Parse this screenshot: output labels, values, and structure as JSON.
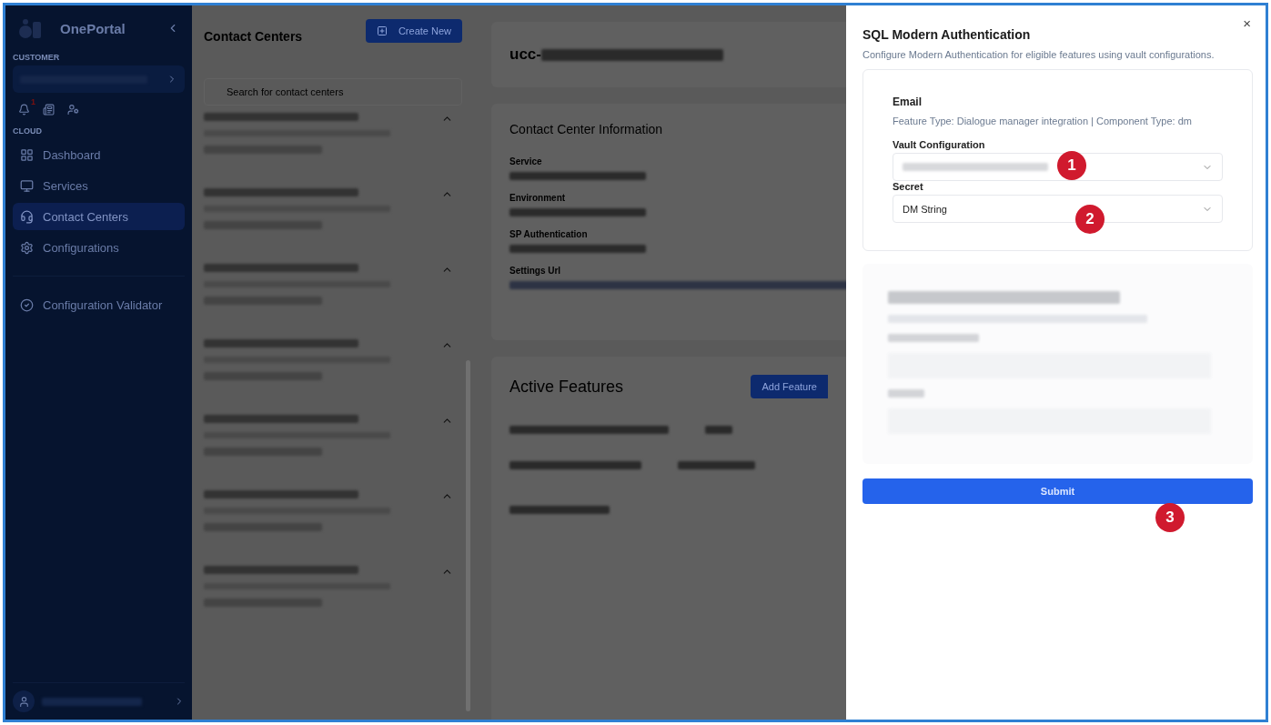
{
  "sidebar": {
    "brand": "OnePortal",
    "customer_label": "CUSTOMER",
    "notification_count": "1",
    "cloud_label": "CLOUD",
    "items": [
      {
        "label": "Dashboard",
        "kind": "grid",
        "selected": false
      },
      {
        "label": "Services",
        "kind": "monitor",
        "selected": false
      },
      {
        "label": "Contact Centers",
        "kind": "headset",
        "selected": true
      },
      {
        "label": "Configurations",
        "kind": "gear",
        "selected": false
      }
    ],
    "footer_items": [
      {
        "label": "Configuration Validator",
        "kind": "check",
        "selected": false
      }
    ]
  },
  "contact_centers": {
    "title": "Contact Centers",
    "create_button": "Create New",
    "search": {
      "placeholder": "Search for contact centers"
    },
    "items": [
      {
        "expanded": true
      },
      {
        "expanded": true
      },
      {
        "expanded": true
      },
      {
        "expanded": true
      },
      {
        "expanded": true
      },
      {
        "expanded": true
      },
      {
        "expanded": true
      }
    ]
  },
  "detail": {
    "title_prefix": "ucc-",
    "info_title": "Contact Center Information",
    "fields": [
      "Service",
      "Environment",
      "SP Authentication",
      "Settings Url"
    ],
    "features_title": "Active Features",
    "add_button": "Add Feature"
  },
  "dialog": {
    "title": "SQL Modern Authentication",
    "description": "Configure Modern Authentication for eligible features using vault configurations.",
    "feature": {
      "name": "Email",
      "meta": "Feature Type: Dialogue manager integration | Component Type: dm"
    },
    "fields": [
      {
        "label": "Vault Configuration",
        "badge": "1"
      },
      {
        "label": "Secret",
        "value": "DM String",
        "badge": "2"
      }
    ],
    "submit": "Submit",
    "submit_badge": "3",
    "close": "×"
  }
}
